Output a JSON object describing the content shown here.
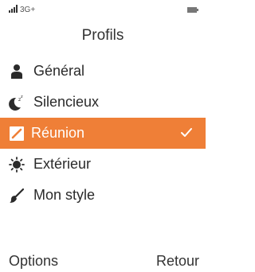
{
  "status_bar": {
    "network": "3G+",
    "icons": [
      "signal-icon",
      "battery-icon"
    ]
  },
  "screen": {
    "title": "Profils"
  },
  "profiles": [
    {
      "label": "Général",
      "icon": "person-icon",
      "selected": false
    },
    {
      "label": "Silencieux",
      "icon": "moon-sleep-icon",
      "selected": false
    },
    {
      "label": "Réunion",
      "icon": "meeting-icon",
      "selected": true
    },
    {
      "label": "Extérieur",
      "icon": "sun-icon",
      "selected": false
    },
    {
      "label": "Mon style",
      "icon": "brush-icon",
      "selected": false
    }
  ],
  "softkeys": {
    "left": "Options",
    "right": "Retour"
  },
  "colors": {
    "accent": "#ef7f37",
    "text": "#2a2a2a",
    "background": "#ffffff"
  }
}
